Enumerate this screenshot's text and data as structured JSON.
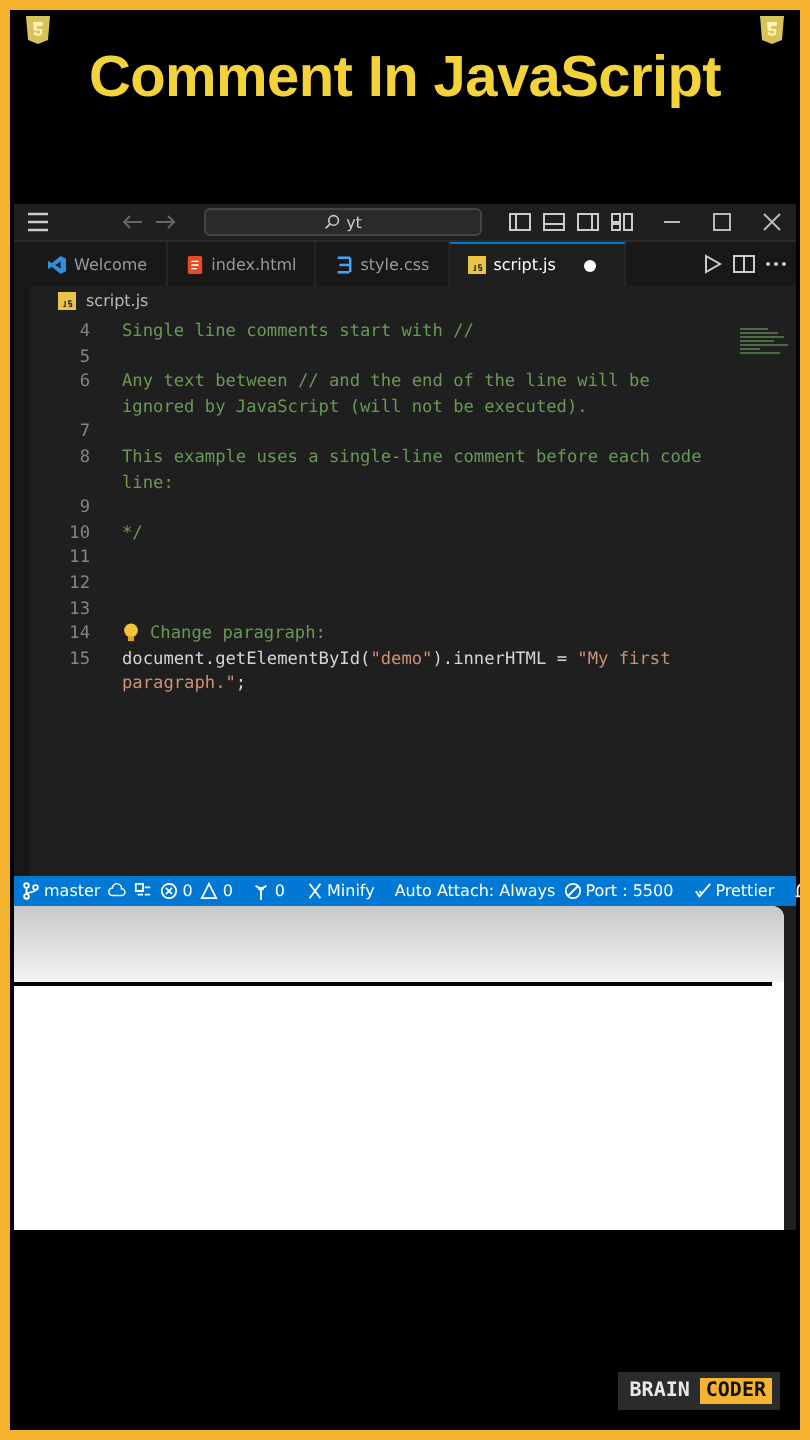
{
  "heading": "Comment In JavaScript",
  "titlebar": {
    "search": "yt"
  },
  "tabs": [
    {
      "label": "Welcome",
      "kind": "vscode",
      "selected": false,
      "dirty": false
    },
    {
      "label": "index.html",
      "kind": "html",
      "selected": false,
      "dirty": false
    },
    {
      "label": "style.css",
      "kind": "css",
      "selected": false,
      "dirty": false
    },
    {
      "label": "script.js",
      "kind": "js",
      "selected": true,
      "dirty": true
    }
  ],
  "breadcrumb": "script.js",
  "code_lines": [
    {
      "number": "4",
      "segments": [
        {
          "text": "Single line comments start with //",
          "kind": "comment"
        }
      ]
    },
    {
      "number": "5"
    },
    {
      "number": "6",
      "segments": [
        {
          "text": "Any text between // and the end of the line will be ignored by JavaScript (will not be executed).",
          "kind": "comment"
        }
      ]
    },
    {
      "number": "7"
    },
    {
      "number": "8",
      "segments": [
        {
          "text": "This example uses a single-line comment before each code line:",
          "kind": "comment"
        }
      ]
    },
    {
      "number": "9"
    },
    {
      "number": "10",
      "segments": [
        {
          "text": "*/",
          "kind": "comment"
        }
      ]
    },
    {
      "number": "11"
    },
    {
      "number": "12"
    },
    {
      "number": "13"
    },
    {
      "number": "14",
      "bulb": true,
      "segments": [
        {
          "text": "Change paragraph:",
          "kind": "comment"
        }
      ]
    },
    {
      "number": "15",
      "segments": [
        {
          "text": "document.getElementById(",
          "kind": "plain"
        },
        {
          "text": "\"demo\"",
          "kind": "string"
        },
        {
          "text": ").innerHTML = ",
          "kind": "plain"
        },
        {
          "text": "\"My first paragraph.\"",
          "kind": "string"
        },
        {
          "text": ";",
          "kind": "plain"
        }
      ]
    }
  ],
  "status_bar": [
    {
      "kind": "branch",
      "label": "master"
    },
    {
      "kind": "sync"
    },
    {
      "kind": "tools"
    },
    {
      "kind": "errors",
      "label": "0"
    },
    {
      "kind": "warnings",
      "label": "0"
    },
    {
      "kind": "ports",
      "label": "0"
    },
    {
      "kind": "minify",
      "label": "Minify"
    },
    {
      "kind": "text",
      "label": "Auto Attach: Always"
    },
    {
      "kind": "port",
      "label": "Port : 5500"
    },
    {
      "kind": "prettier",
      "label": "Prettier"
    },
    {
      "kind": "bell"
    }
  ],
  "logo": {
    "left": "BRAIN",
    "right": "CODER"
  }
}
